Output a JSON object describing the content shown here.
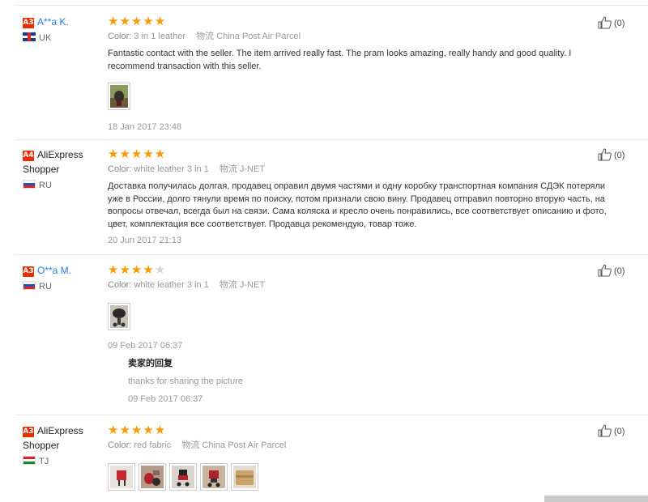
{
  "reviews": [
    {
      "level": "A3",
      "name": "A**a K.",
      "country": "UK",
      "rating": 5,
      "color_label": "Color:",
      "color_value": "3 in 1 leather",
      "shipping_label": "物流",
      "shipping_value": "China Post Air Parcel",
      "text": "Fantastic contact with the seller. The item arrived really fast. The pram looks amazing, really handy and good quality. I recommend transaction with this seller.",
      "photo_count": 1,
      "date": "18 Jan 2017 23:48",
      "helpful": "(0)"
    },
    {
      "level": "A4",
      "name": "AliExpress Shopper",
      "country": "RU",
      "rating": 5,
      "color_label": "Color:",
      "color_value": "white leather 3 in 1",
      "shipping_label": "物流",
      "shipping_value": "J-NET",
      "text": "Доставка получилась долгая, продавец оправил двумя частями и одну коробку транспортная компания СДЭК потеряли уже в России, долго тянули время по поиску, потом признали свою вину. Продавец отправил повторно вторую часть, на вопросы отвечал, всегда был на связи. Сама коляска и кресло очень понравились, все соответствует описанию и фото, цвет, комплектация все соответствует. Продавца рекомендую, товар тоже.",
      "photo_count": 0,
      "date": "20 Jun 2017 21:13",
      "helpful": "(0)"
    },
    {
      "level": "A3",
      "name": "O**a M.",
      "country": "RU",
      "rating": 4,
      "color_label": "Color:",
      "color_value": "white leather 3 in 1",
      "shipping_label": "物流",
      "shipping_value": "J-NET",
      "text": "",
      "photo_count": 1,
      "date": "09 Feb 2017 06:37",
      "reply": {
        "title": "卖家的回复",
        "text": "thanks for sharing the picture",
        "date": "09 Feb 2017 06:37"
      },
      "helpful": "(0)"
    },
    {
      "level": "A3",
      "name": "AliExpress Shopper",
      "country": "TJ",
      "rating": 5,
      "color_label": "Color:",
      "color_value": "red fabric",
      "shipping_label": "物流",
      "shipping_value": "China Post Air Parcel",
      "text": "",
      "photo_count": 5,
      "date": "",
      "helpful": "(0)"
    }
  ]
}
